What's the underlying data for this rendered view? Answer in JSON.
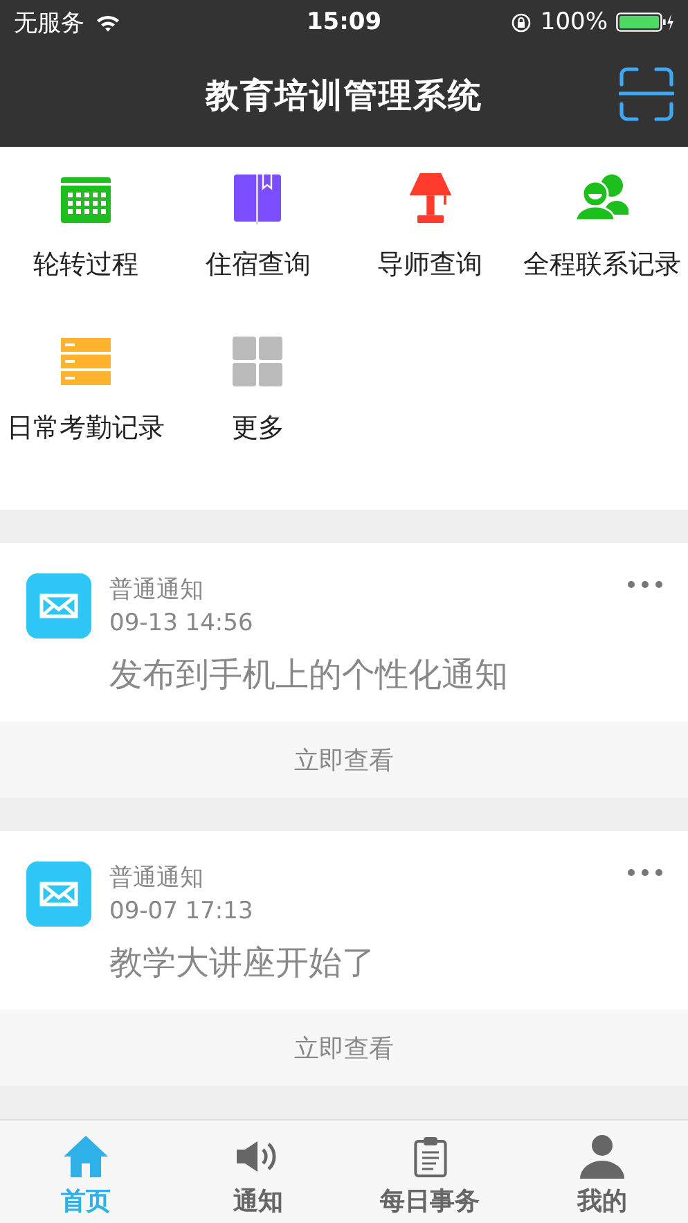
{
  "status_bar": {
    "carrier": "无服务",
    "time": "15:09",
    "battery": "100%"
  },
  "nav": {
    "title": "教育培训管理系统"
  },
  "shortcuts": [
    {
      "label": "轮转过程"
    },
    {
      "label": "住宿查询"
    },
    {
      "label": "导师查询"
    },
    {
      "label": "全程联系记录"
    },
    {
      "label": "日常考勤记录"
    },
    {
      "label": "更多"
    }
  ],
  "notices": [
    {
      "title": "普通通知",
      "time": "09-13 14:56",
      "body": "发布到手机上的个性化通知",
      "action": "立即查看"
    },
    {
      "title": "普通通知",
      "time": "09-07 17:13",
      "body": "教学大讲座开始了",
      "action": "立即查看"
    }
  ],
  "tabs": [
    {
      "label": "首页",
      "selected": true
    },
    {
      "label": "通知",
      "selected": false
    },
    {
      "label": "每日事务",
      "selected": false
    },
    {
      "label": "我的",
      "selected": false
    }
  ]
}
